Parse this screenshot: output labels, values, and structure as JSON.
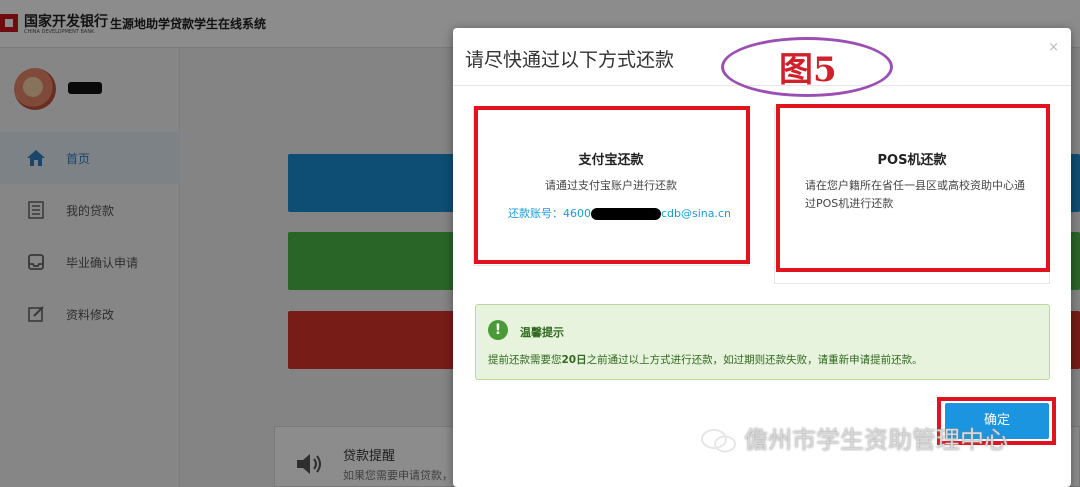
{
  "app": {
    "bank_name": "国家开发银行",
    "bank_name_en": "CHINA DEVELOPMENT BANK",
    "system_name": "生源地助学贷款学生在线系统",
    "sidebar": {
      "items": [
        {
          "label": "首页",
          "icon": "home-icon"
        },
        {
          "label": "我的贷款",
          "icon": "list-icon"
        },
        {
          "label": "毕业确认申请",
          "icon": "inbox-icon"
        },
        {
          "label": "资料修改",
          "icon": "edit-icon"
        }
      ]
    },
    "notice": {
      "title": "贷款提醒",
      "text": "如果您需要申请贷款，请查看生源地贷款申请流程"
    }
  },
  "modal": {
    "title": "请尽快通过以下方式还款",
    "close": "×",
    "figure_label": "图5",
    "alipay": {
      "title": "支付宝还款",
      "desc": "请通过支付宝账户进行还款",
      "account_prefix": "还款账号：4600",
      "account_suffix": "cdb@sina.cn"
    },
    "pos": {
      "title": "POS机还款",
      "desc": "请在您户籍所在省任一县区或高校资助中心通过POS机进行还款"
    },
    "tip": {
      "title": "温馨提示",
      "text_before": "提前还款需要您",
      "text_bold": "20日",
      "text_after": "之前通过以上方式进行还款，如过期则还款失败，请重新申请提前还款。"
    },
    "confirm_label": "确定"
  },
  "watermark": "儋州市学生资助管理中心",
  "colors": {
    "accent_blue": "#1b95e0",
    "bar_blue": "#1b8fd6",
    "bar_green": "#4cb848",
    "bar_red": "#d9342b",
    "highlight_red": "#e0141e",
    "ellipse_purple": "#9b4fb3"
  }
}
